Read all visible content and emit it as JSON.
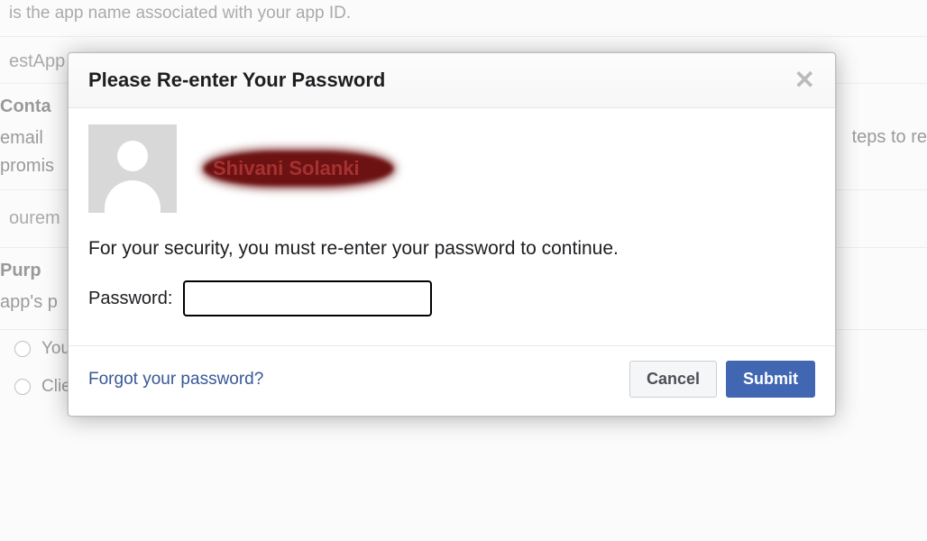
{
  "background": {
    "line1": "is the app name associated with your app ID.",
    "line2": "estApp",
    "line3_label": "Conta",
    "line3_sub1": "email ",
    "line3_sub2": "promis",
    "line4": "ourem",
    "line5_label": "Purp",
    "line5_sub": "app's p",
    "radio1": "Your",
    "radio2": "Clients",
    "right_fragment": "teps to re"
  },
  "modal": {
    "title": "Please Re-enter Your Password",
    "username": "Shivani Solanki",
    "security_text": "For your security, you must re-enter your password to continue.",
    "password_label": "Password:",
    "password_value": "",
    "forgot_link": "Forgot your password?",
    "cancel_label": "Cancel",
    "submit_label": "Submit"
  }
}
